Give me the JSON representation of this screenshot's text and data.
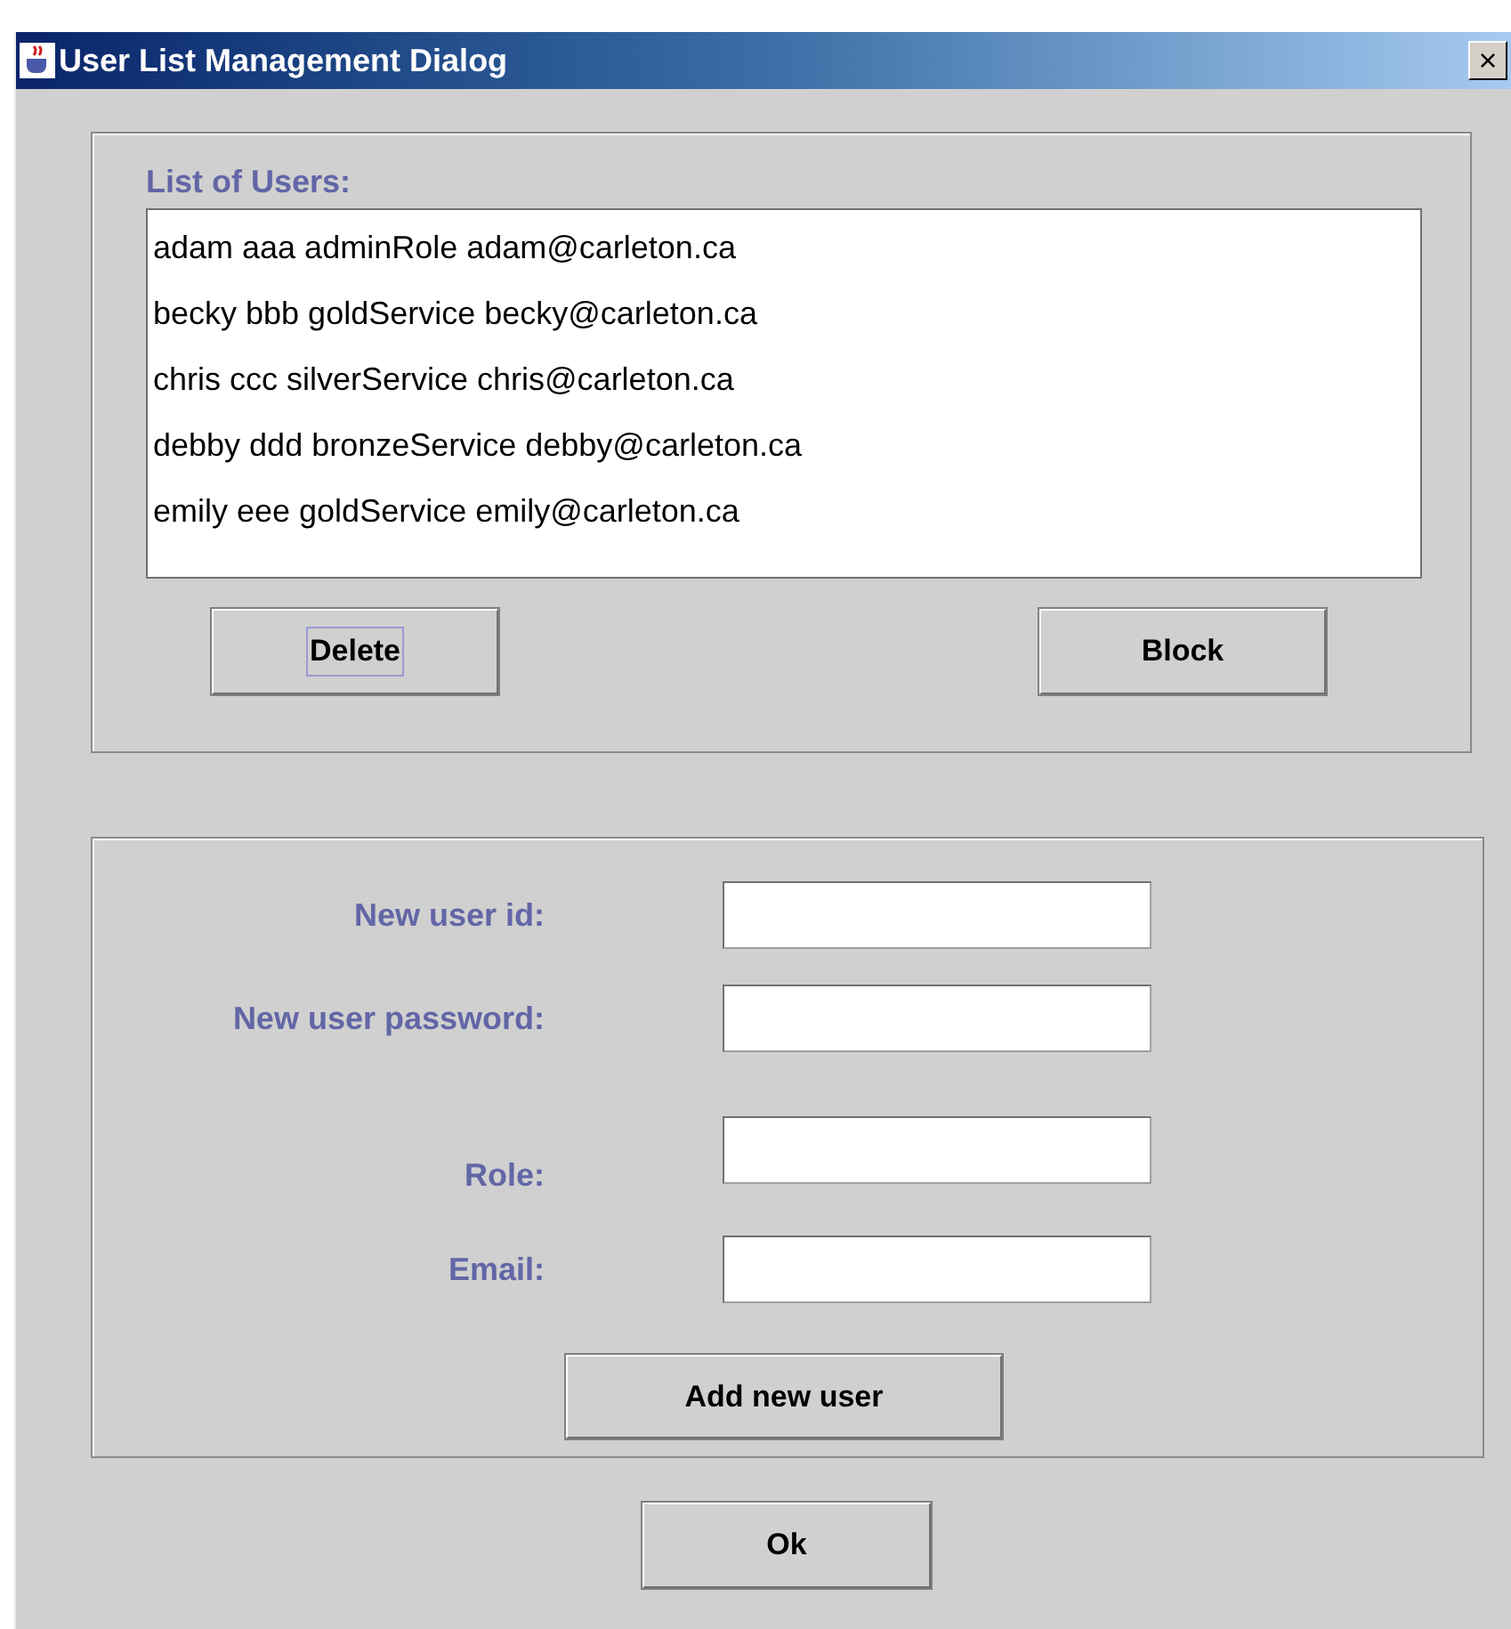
{
  "window": {
    "title": "User List Management Dialog",
    "close": "×"
  },
  "users": {
    "label": "List of Users:",
    "items": [
      {
        "text": "adam aaa adminRole adam@carleton.ca",
        "selected": false
      },
      {
        "text": "becky bbb goldService becky@carleton.ca",
        "selected": false
      },
      {
        "text": "chris ccc silverService chris@carleton.ca",
        "selected": false
      },
      {
        "text": "debby ddd bronzeService debby@carleton.ca",
        "selected": false
      },
      {
        "text": "emily eee goldService emily@carleton.ca",
        "selected": false
      }
    ],
    "buttons": [
      {
        "label": "Delete",
        "focused": true
      },
      {
        "label": "Block",
        "focused": false
      }
    ]
  },
  "new_user": {
    "fields": [
      {
        "label": "New user id:"
      },
      {
        "label": "New user password:"
      },
      {
        "label": "Role:"
      },
      {
        "label": "Email:"
      }
    ],
    "button": "Add new user"
  },
  "ok": "Ok"
}
